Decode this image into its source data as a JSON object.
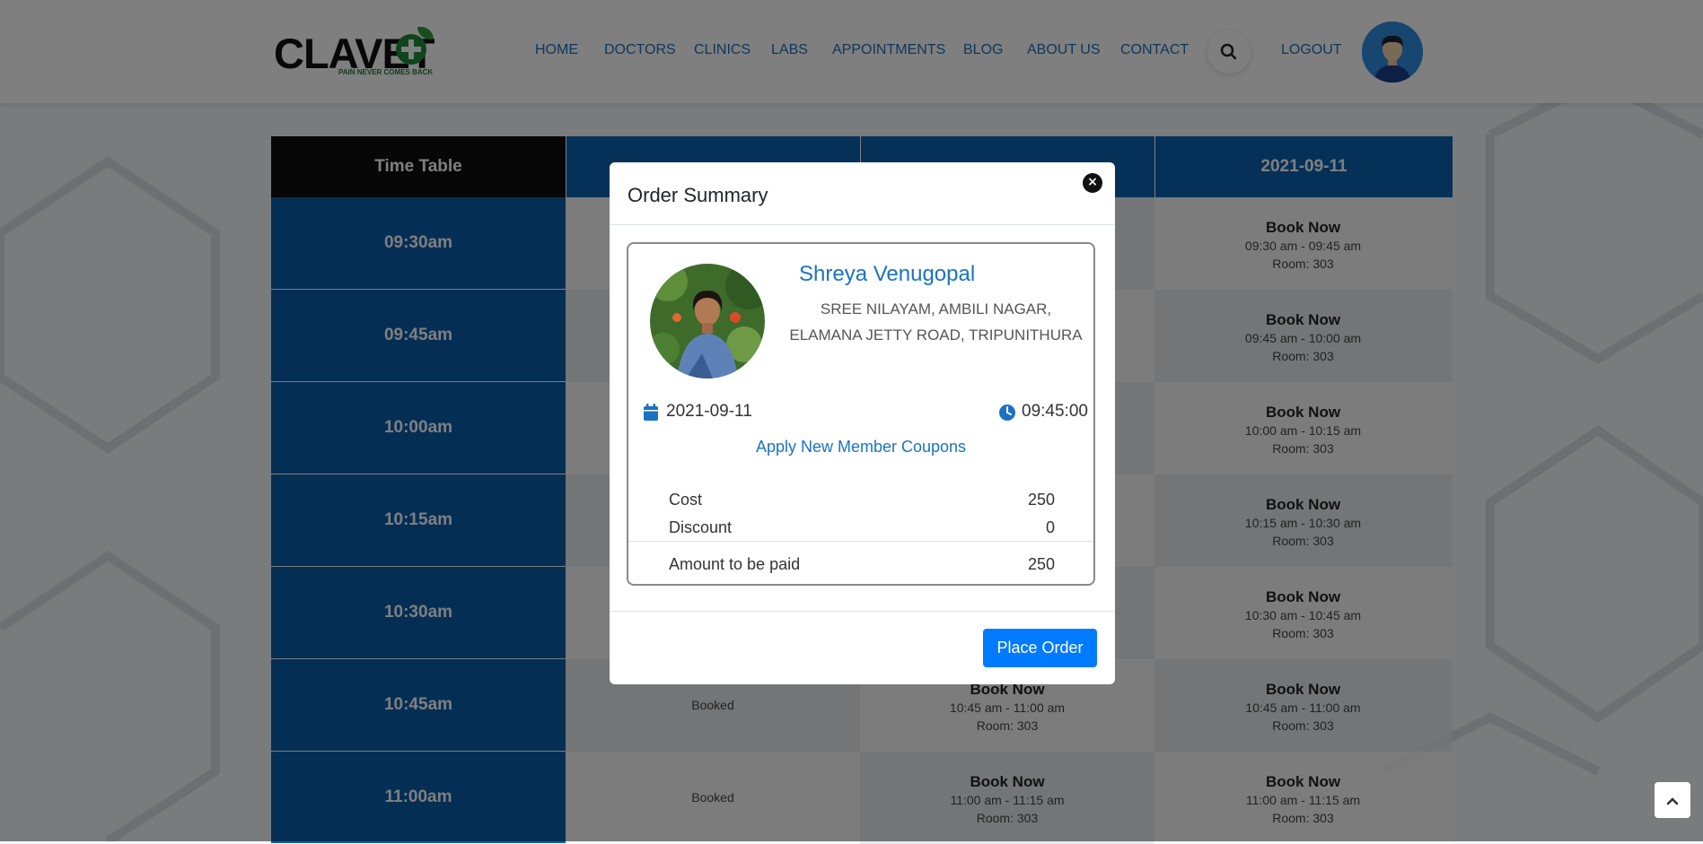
{
  "header": {
    "logo_text": "CLAVET",
    "logo_tagline": "PAIN NEVER COMES BACK",
    "nav": [
      "HOME",
      "DOCTORS",
      "CLINICS",
      "LABS",
      "APPOINTMENTS",
      "BLOG",
      "ABOUT US",
      "CONTACT"
    ],
    "logout_label": "LOGOUT"
  },
  "timetable": {
    "header_label": "Time Table",
    "date_columns": [
      "",
      "",
      "2021-09-11"
    ],
    "rows": [
      {
        "time": "09:30am",
        "c1": "",
        "c2": "",
        "c3": {
          "book": "Book Now",
          "range": "09:30 am - 09:45 am",
          "room": "Room: 303"
        }
      },
      {
        "time": "09:45am",
        "c1": "",
        "c2": "",
        "c3": {
          "book": "Book Now",
          "range": "09:45 am - 10:00 am",
          "room": "Room: 303"
        }
      },
      {
        "time": "10:00am",
        "c1": "",
        "c2": "",
        "c3": {
          "book": "Book Now",
          "range": "10:00 am - 10:15 am",
          "room": "Room: 303"
        }
      },
      {
        "time": "10:15am",
        "c1": "",
        "c2": "",
        "c3": {
          "book": "Book Now",
          "range": "10:15 am - 10:30 am",
          "room": "Room: 303"
        }
      },
      {
        "time": "10:30am",
        "c1": "",
        "c2": "",
        "c3": {
          "book": "Book Now",
          "range": "10:30 am - 10:45 am",
          "room": "Room: 303"
        }
      },
      {
        "time": "10:45am",
        "c1": "Booked",
        "c2": {
          "book": "Book Now",
          "range": "10:45 am - 11:00 am",
          "room": "Room: 303"
        },
        "c3": {
          "book": "Book Now",
          "range": "10:45 am - 11:00 am",
          "room": "Room: 303"
        }
      },
      {
        "time": "11:00am",
        "c1": "Booked",
        "c2": {
          "book": "Book Now",
          "range": "11:00 am - 11:15 am",
          "room": "Room: 303"
        },
        "c3": {
          "book": "Book Now",
          "range": "11:00 am - 11:15 am",
          "room": "Room: 303"
        }
      }
    ]
  },
  "modal": {
    "title": "Order Summary",
    "close_label": "×",
    "doctor_name": "Shreya Venugopal",
    "address_line1": "SREE NILAYAM, AMBILI NAGAR,",
    "address_line2": "ELAMANA JETTY ROAD, TRIPUNITHURA",
    "date": "2021-09-11",
    "time": "09:45:00",
    "coupon_link": "Apply New Member Coupons",
    "cost_label": "Cost",
    "cost_value": "250",
    "discount_label": "Discount",
    "discount_value": "0",
    "amount_label": "Amount to be paid",
    "amount_value": "250",
    "place_order_label": "Place Order"
  },
  "colors": {
    "brand_blue": "#0b63b3",
    "link_blue": "#1a73c2",
    "button_blue": "#007bff",
    "logo_green": "#1f8a3a"
  }
}
